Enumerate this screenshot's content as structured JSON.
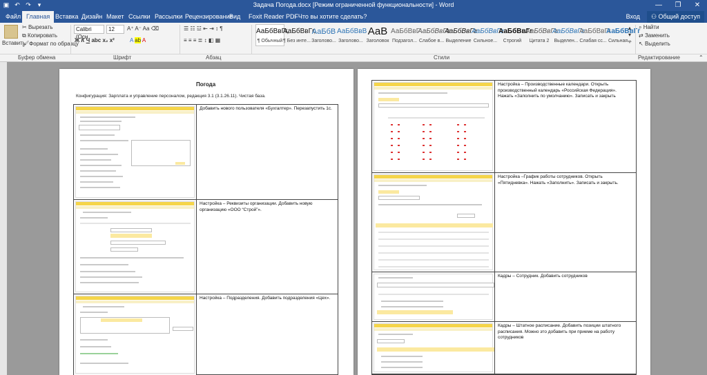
{
  "window": {
    "title": "Задача Погода.docx [Режим ограниченной функциональности] - Word",
    "controls": [
      "—",
      "❐",
      "✕"
    ]
  },
  "tabs": {
    "items": [
      "Файл",
      "Главная",
      "Вставка",
      "Дизайн",
      "Макет",
      "Ссылки",
      "Рассылки",
      "Рецензирование",
      "Вид",
      "Foxit Reader PDF"
    ],
    "tell_me": "Что вы хотите сделать?",
    "sign_in": "Вход",
    "share": "Общий доступ"
  },
  "ribbon": {
    "clipboard": {
      "paste": "Вставить",
      "cut": "Вырезать",
      "copy": "Копировать",
      "format_painter": "Формат по образцу",
      "label": "Буфер обмена"
    },
    "font": {
      "name": "Calibri (Осн",
      "size": "12",
      "label": "Шрифт"
    },
    "paragraph": {
      "label": "Абзац"
    },
    "styles": {
      "label": "Стили",
      "items": [
        {
          "preview": "АаБбВвГг,",
          "name": "¶ Обычный"
        },
        {
          "preview": "АаБбВвГг,",
          "name": "¶ Без инте..."
        },
        {
          "preview": "АаБбВ",
          "name": "Заголово..."
        },
        {
          "preview": "АаБбВвВ",
          "name": "Заголово..."
        },
        {
          "preview": "АаВ",
          "name": "Заголовок"
        },
        {
          "preview": "АаБбВвГ",
          "name": "Подзагол..."
        },
        {
          "preview": "АаБбВвГг",
          "name": "Слабое в..."
        },
        {
          "preview": "АаБбВвГг",
          "name": "Выделение"
        },
        {
          "preview": "АаБбВвГг",
          "name": "Сильное..."
        },
        {
          "preview": "АаБбВвГг",
          "name": "Строгий"
        },
        {
          "preview": "АаБбВвГг",
          "name": "Цитата 2"
        },
        {
          "preview": "АаБбВвГг",
          "name": "Выделен..."
        },
        {
          "preview": "АаБбВвГг",
          "name": "Слабая сс..."
        },
        {
          "preview": "АаБбВвГг",
          "name": "Сильная..."
        }
      ]
    },
    "editing": {
      "find": "Найти",
      "replace": "Заменить",
      "select": "Выделить",
      "label": "Редактирование"
    }
  },
  "doc": {
    "title": "Погода",
    "config": "Конфигурация: Зарплата и управление персоналом, редакция 3.1 (3.1.26.11). Чистая база.",
    "left_rows": [
      {
        "text": "Добавить нового пользователя «Бухгалтер». Перезапустить 1с."
      },
      {
        "text": "Настройка – Реквизиты организации. Добавить новую организацию «ООО “Строй”»."
      },
      {
        "text": "Настройка – Подразделения. Добавить подразделения «Цех»."
      }
    ],
    "right_rows": [
      {
        "text": "Настройка – Производственные календари. Открыть производственный календарь «Российская Федерация». Нажать «Заполнить по умолчанию». Записать и закрыть"
      },
      {
        "text": "Настройка –График работы сотрудников. Открыть «Пятидневка». Нажать «Заполнить». Записать и закрыть."
      },
      {
        "text": "Кадры – Сотрудник. Добавить сотрудников"
      },
      {
        "text": "Кадры – Штатное расписание. Добавить позиции штатного расписания. Можно это добавить при приеме на работу сотрудников"
      }
    ]
  },
  "colors": {
    "titlebar": "#2b579a",
    "ribbon": "#f3f3f3",
    "app_yellow": "#f5d54a"
  }
}
